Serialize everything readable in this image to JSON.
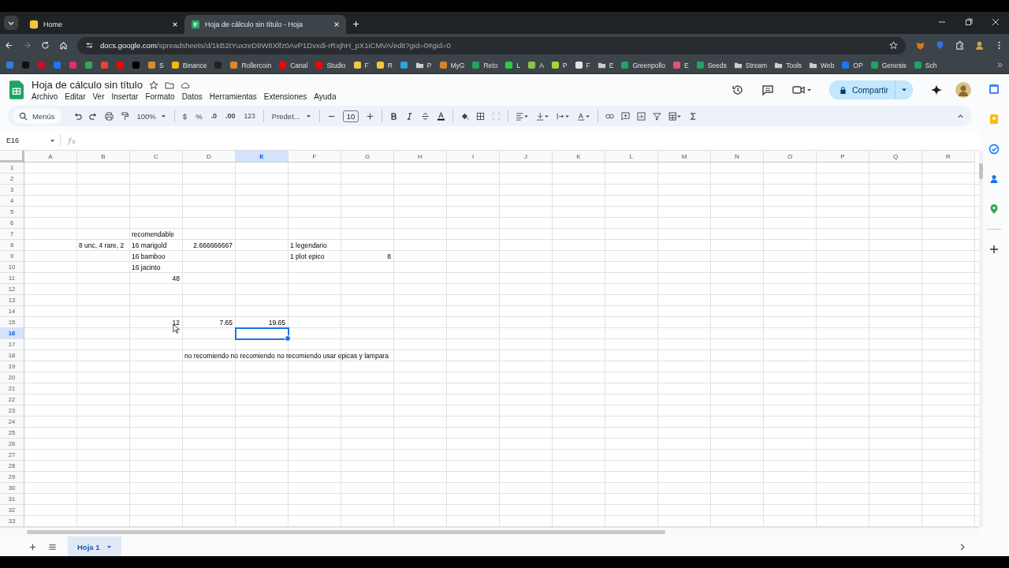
{
  "browser": {
    "tabs": [
      {
        "title": "Home",
        "selected": false
      },
      {
        "title": "Hoja de cálculo sin título - Hoja",
        "selected": true
      }
    ],
    "url": {
      "host": "docs.google.com",
      "path": "/spreadsheets/d/1kB2tYuxzeD9W8Xlfz0AvP1Dvxdi-rRxjhH_pX1iCMVA/edit?gid=0#gid=0"
    },
    "bookmarks": [
      {
        "kind": "icon",
        "color": "#2f7fd6"
      },
      {
        "kind": "icon",
        "color": "#111111"
      },
      {
        "kind": "icon",
        "color": "#c8102e"
      },
      {
        "kind": "icon",
        "color": "#1877f2"
      },
      {
        "kind": "icon",
        "color": "#e1306c"
      },
      {
        "kind": "icon",
        "color": "#34a853"
      },
      {
        "kind": "icon",
        "color": "#ea4335"
      },
      {
        "kind": "icon",
        "color": "#ff0000"
      },
      {
        "kind": "icon",
        "color": "#000000"
      },
      {
        "kind": "link",
        "label": "S",
        "color": "#d98a2b"
      },
      {
        "kind": "link",
        "label": "Binance",
        "color": "#f0b90b"
      },
      {
        "kind": "icon",
        "color": "#222222"
      },
      {
        "kind": "link",
        "label": "Rollercoin",
        "color": "#d98a2b"
      },
      {
        "kind": "link",
        "label": "Canal",
        "color": "#ff0000"
      },
      {
        "kind": "link",
        "label": "Studio",
        "color": "#ff0000"
      },
      {
        "kind": "link",
        "label": "F",
        "color": "#f5c542"
      },
      {
        "kind": "link",
        "label": "R",
        "color": "#f5c542"
      },
      {
        "kind": "icon",
        "color": "#2aa3df"
      },
      {
        "kind": "folder",
        "label": "P",
        "color": "#c8cdd2"
      },
      {
        "kind": "link",
        "label": "MyG",
        "color": "#d9822b"
      },
      {
        "kind": "link",
        "label": "Reto",
        "color": "#1fa463"
      },
      {
        "kind": "link",
        "label": "L",
        "color": "#2ecc40"
      },
      {
        "kind": "link",
        "label": "A",
        "color": "#8bc34a"
      },
      {
        "kind": "link",
        "label": "P",
        "color": "#a5d63a"
      },
      {
        "kind": "link",
        "label": "F",
        "color": "#dfe3e6"
      },
      {
        "kind": "folder",
        "label": "E",
        "color": "#c8cdd2"
      },
      {
        "kind": "link",
        "label": "Greenpollo",
        "color": "#1fa463"
      },
      {
        "kind": "link",
        "label": "E",
        "color": "#e05570"
      },
      {
        "kind": "link",
        "label": "Seeds",
        "color": "#1fa463"
      },
      {
        "kind": "folder",
        "label": "Stream",
        "color": "#c8cdd2"
      },
      {
        "kind": "folder",
        "label": "Tools",
        "color": "#c8cdd2"
      },
      {
        "kind": "folder",
        "label": "Web",
        "color": "#c8cdd2"
      },
      {
        "kind": "link",
        "label": "OP",
        "color": "#1877f2"
      },
      {
        "kind": "link",
        "label": "Genesis",
        "color": "#1fa463"
      },
      {
        "kind": "link",
        "label": "Sch",
        "color": "#1fa463"
      }
    ]
  },
  "doc": {
    "title": "Hoja de cálculo sin título",
    "menu": [
      "Archivo",
      "Editar",
      "Ver",
      "Insertar",
      "Formato",
      "Datos",
      "Herramientas",
      "Extensiones",
      "Ayuda"
    ],
    "share": "Compartir"
  },
  "toolbar": {
    "search": "Menús",
    "zoom": "100%",
    "currency": "$",
    "percent": "%",
    "decrease_decimals": ".0",
    "increase_decimals": ".00",
    "number_format": "123",
    "font": "Predet...",
    "font_size": "10"
  },
  "formula_bar": {
    "name_box": "E16"
  },
  "grid": {
    "columns": [
      {
        "label": "A",
        "selected": false
      },
      {
        "label": "B",
        "selected": false
      },
      {
        "label": "C",
        "selected": false
      },
      {
        "label": "D",
        "selected": false
      },
      {
        "label": "E",
        "selected": true
      },
      {
        "label": "F",
        "selected": false
      },
      {
        "label": "G",
        "selected": false
      },
      {
        "label": "H",
        "selected": false
      },
      {
        "label": "I",
        "selected": false
      },
      {
        "label": "J",
        "selected": false
      },
      {
        "label": "K",
        "selected": false
      },
      {
        "label": "L",
        "selected": false
      },
      {
        "label": "M",
        "selected": false
      },
      {
        "label": "N",
        "selected": false
      },
      {
        "label": "O",
        "selected": false
      },
      {
        "label": "P",
        "selected": false
      },
      {
        "label": "Q",
        "selected": false
      },
      {
        "label": "R",
        "selected": false
      }
    ],
    "rows": [
      {
        "label": "1",
        "selected": false
      },
      {
        "label": "2",
        "selected": false
      },
      {
        "label": "3",
        "selected": false
      },
      {
        "label": "4",
        "selected": false
      },
      {
        "label": "5",
        "selected": false
      },
      {
        "label": "6",
        "selected": false
      },
      {
        "label": "7",
        "selected": false,
        "cells": {
          "C": {
            "kind": "text",
            "text": "recomendable"
          }
        }
      },
      {
        "label": "8",
        "selected": false,
        "cells": {
          "B": {
            "kind": "text",
            "text": "8 unc, 4 rare, 2"
          },
          "C": {
            "kind": "text",
            "text": "16 marigold"
          },
          "D": {
            "kind": "number",
            "text": "2.666666667"
          },
          "F": {
            "kind": "text",
            "text": "1 legendario"
          }
        }
      },
      {
        "label": "9",
        "selected": false,
        "cells": {
          "C": {
            "kind": "text",
            "text": "16 bamboo"
          },
          "F": {
            "kind": "text",
            "text": "1 plot epico"
          },
          "G": {
            "kind": "number",
            "text": "8"
          }
        }
      },
      {
        "label": "10",
        "selected": false,
        "cells": {
          "C": {
            "kind": "text",
            "text": "16 jacinto"
          }
        }
      },
      {
        "label": "11",
        "selected": false,
        "cells": {
          "C": {
            "kind": "number",
            "text": "48"
          }
        }
      },
      {
        "label": "12",
        "selected": false
      },
      {
        "label": "13",
        "selected": false
      },
      {
        "label": "14",
        "selected": false
      },
      {
        "label": "15",
        "selected": false,
        "cells": {
          "C": {
            "kind": "number",
            "text": "12"
          },
          "D": {
            "kind": "number",
            "text": "7.65"
          },
          "E": {
            "kind": "number",
            "text": "19.65"
          }
        }
      },
      {
        "label": "16",
        "selected": true
      },
      {
        "label": "17",
        "selected": false
      },
      {
        "label": "18",
        "selected": false,
        "cells": {
          "D": {
            "kind": "text",
            "text": "no recomiendo no recomiendo no recomiendo usar epicas y lampara"
          }
        }
      },
      {
        "label": "19",
        "selected": false
      },
      {
        "label": "20",
        "selected": false
      },
      {
        "label": "21",
        "selected": false
      },
      {
        "label": "22",
        "selected": false
      },
      {
        "label": "23",
        "selected": false
      },
      {
        "label": "24",
        "selected": false
      },
      {
        "label": "25",
        "selected": false
      },
      {
        "label": "26",
        "selected": false
      },
      {
        "label": "27",
        "selected": false
      },
      {
        "label": "28",
        "selected": false
      },
      {
        "label": "29",
        "selected": false
      },
      {
        "label": "30",
        "selected": false
      },
      {
        "label": "31",
        "selected": false
      },
      {
        "label": "32",
        "selected": false
      },
      {
        "label": "33",
        "selected": false
      }
    ]
  },
  "sheets": [
    {
      "name": "Hoja 1",
      "selected": true
    }
  ]
}
